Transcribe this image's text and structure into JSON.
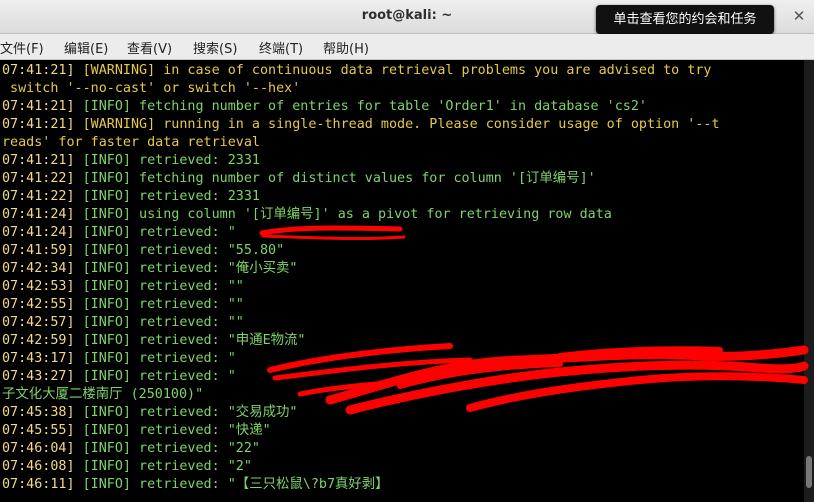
{
  "window": {
    "title": "root@kali: ~"
  },
  "tooltip": {
    "text": "单击查看您的约会和任务"
  },
  "menu": [
    {
      "label": "文件(F)"
    },
    {
      "label": "编辑(E)"
    },
    {
      "label": "查看(V)"
    },
    {
      "label": "搜索(S)"
    },
    {
      "label": "终端(T)"
    },
    {
      "label": "帮助(H)"
    }
  ],
  "terminal": {
    "lines": [
      {
        "ts": "07:41:21]",
        "rest": " [WARNING] in case of continuous data retrieval problems you are advised to try",
        "level": "warn"
      },
      {
        "ts": "",
        "rest": " switch '--no-cast' or switch '--hex'",
        "level": "warn"
      },
      {
        "ts": "07:41:21]",
        "rest": " [INFO] fetching number of entries for table 'Order1' in database 'cs2'",
        "level": "info"
      },
      {
        "ts": "07:41:21]",
        "rest": " [WARNING] running in a single-thread mode. Please consider usage of option '--t",
        "level": "warn"
      },
      {
        "ts": "",
        "rest": "reads' for faster data retrieval",
        "level": "warn"
      },
      {
        "ts": "07:41:21]",
        "rest": " [INFO] retrieved: 2331",
        "level": "info"
      },
      {
        "ts": "07:41:22]",
        "rest": " [INFO] fetching number of distinct values for column '[订单编号]'",
        "level": "info"
      },
      {
        "ts": "07:41:22]",
        "rest": " [INFO] retrieved: 2331",
        "level": "info"
      },
      {
        "ts": "07:41:24]",
        "rest": " [INFO] using column '[订单编号]' as a pivot for retrieving row data",
        "level": "info"
      },
      {
        "ts": "07:41:24]",
        "rest": " [INFO] retrieved: \"",
        "level": "info"
      },
      {
        "ts": "07:41:59]",
        "rest": " [INFO] retrieved: \"55.80\"",
        "level": "info"
      },
      {
        "ts": "07:42:34]",
        "rest": " [INFO] retrieved: \"俺小买卖\"",
        "level": "info"
      },
      {
        "ts": "07:42:53]",
        "rest": " [INFO] retrieved: \"\"",
        "level": "info"
      },
      {
        "ts": "07:42:55]",
        "rest": " [INFO] retrieved: \"\"",
        "level": "info"
      },
      {
        "ts": "07:42:57]",
        "rest": " [INFO] retrieved: \"\"",
        "level": "info"
      },
      {
        "ts": "07:42:59]",
        "rest": " [INFO] retrieved: \"申通E物流\"",
        "level": "info"
      },
      {
        "ts": "07:43:17]",
        "rest": " [INFO] retrieved: \"",
        "level": "info"
      },
      {
        "ts": "07:43:27]",
        "rest": " [INFO] retrieved: \"",
        "level": "info"
      },
      {
        "ts": "",
        "rest": "子文化大厦二楼南厅 (250100)\"",
        "level": "info"
      },
      {
        "ts": "07:45:38]",
        "rest": " [INFO] retrieved: \"交易成功\"",
        "level": "info"
      },
      {
        "ts": "07:45:55]",
        "rest": " [INFO] retrieved: \"快递\"",
        "level": "info"
      },
      {
        "ts": "07:46:04]",
        "rest": " [INFO] retrieved: \"22\"",
        "level": "info"
      },
      {
        "ts": "07:46:08]",
        "rest": " [INFO] retrieved: \"2\"",
        "level": "info"
      },
      {
        "ts": "07:46:11]",
        "rest": " [INFO] retrieved: \"【三只松鼠\\?b7真好剥】",
        "level": "info"
      }
    ]
  },
  "colors": {
    "redaction": "#ff0000",
    "info": "#7fd36a",
    "warning": "#e6c84a",
    "timestamp": "#f2d98a"
  }
}
